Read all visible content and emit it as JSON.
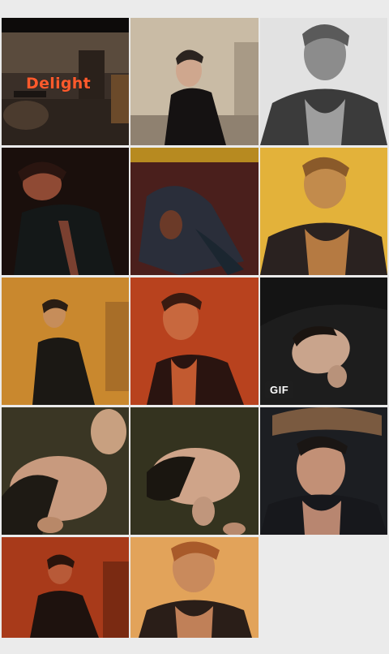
{
  "gallery": {
    "items": [
      {
        "name": "photo-1",
        "overlay_text": "Delight"
      },
      {
        "name": "photo-2"
      },
      {
        "name": "photo-3"
      },
      {
        "name": "photo-4"
      },
      {
        "name": "photo-5"
      },
      {
        "name": "photo-6"
      },
      {
        "name": "photo-7"
      },
      {
        "name": "photo-8"
      },
      {
        "name": "photo-9",
        "badge": "GIF"
      },
      {
        "name": "photo-10"
      },
      {
        "name": "photo-11"
      },
      {
        "name": "photo-12"
      },
      {
        "name": "photo-13"
      },
      {
        "name": "photo-14"
      }
    ]
  },
  "colors": {
    "background": "#ebebeb",
    "accent_text": "#ff5a2c"
  }
}
